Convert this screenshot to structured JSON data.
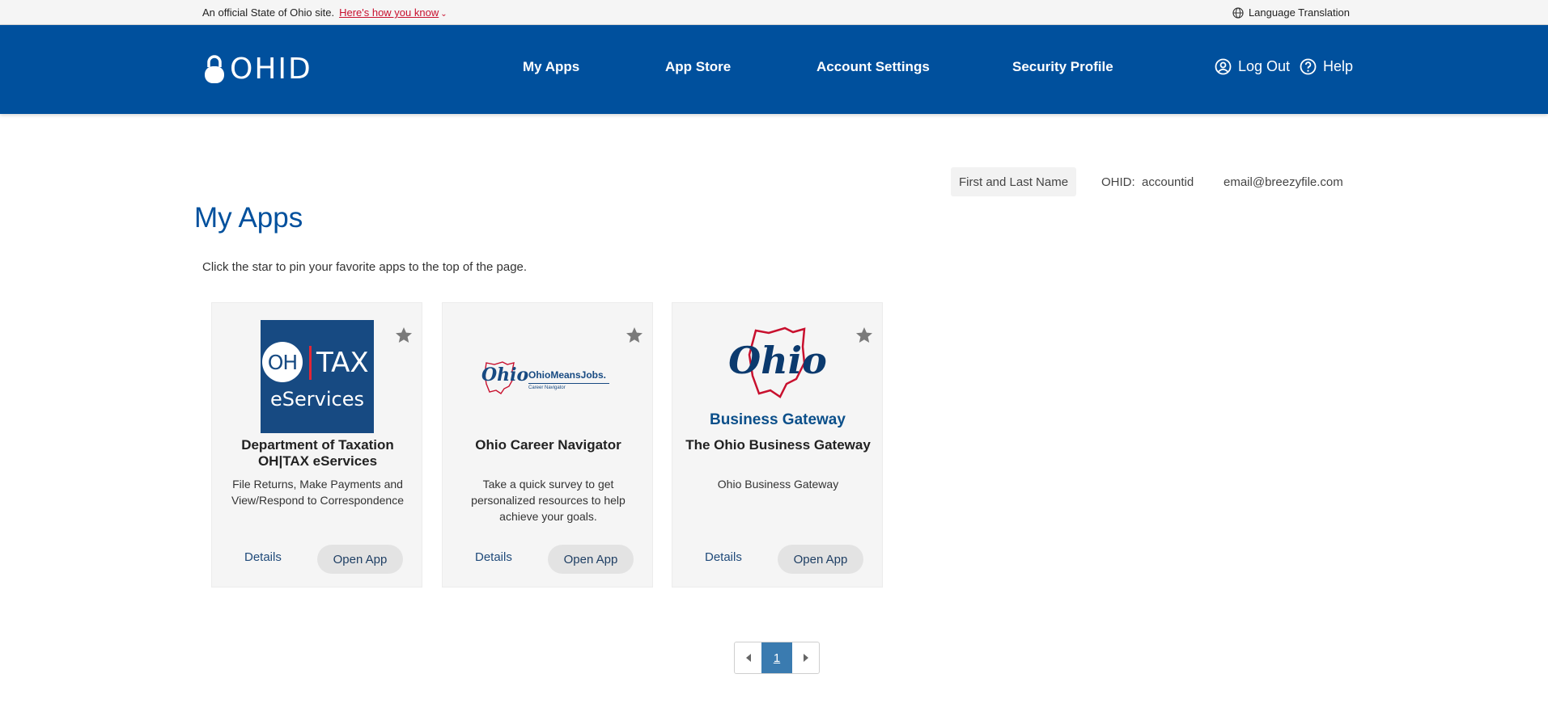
{
  "gov_banner": {
    "text": "An official State of Ohio site.",
    "link": "Here's how you know",
    "language": "Language Translation"
  },
  "header": {
    "logo": "OHID",
    "nav": [
      "My Apps",
      "App Store",
      "Account Settings",
      "Security Profile"
    ],
    "logout": "Log Out",
    "help": "Help"
  },
  "account": {
    "name": "First and Last Name",
    "ohid_label": "OHID:",
    "ohid_value": "accountid",
    "email": "email@breezyfile.com"
  },
  "page": {
    "title": "My Apps",
    "subtitle": "Click the star to pin your favorite apps to the top of the page."
  },
  "cards": [
    {
      "logo_line1_left": "OH",
      "logo_line1_right": "TAX",
      "logo_line2": "eServices",
      "title": "Department of Taxation OH|TAX eServices",
      "desc": "File Returns, Make Payments and View/Respond to Correspondence",
      "details": "Details",
      "open": "Open App"
    },
    {
      "logo_script": "Ohio",
      "logo_brand": "OhioMeansJobs.",
      "logo_tag": "Career Navigator",
      "title": "Ohio Career Navigator",
      "desc": "Take a quick survey to get personalized resources to help achieve your goals.",
      "details": "Details",
      "open": "Open App"
    },
    {
      "logo_script": "Ohio",
      "logo_caption": "Business Gateway",
      "title": "The Ohio Business Gateway",
      "desc": "Ohio Business Gateway",
      "details": "Details",
      "open": "Open App"
    }
  ],
  "pagination": {
    "current": "1"
  },
  "colors": {
    "header_blue": "#00509d",
    "gov_red": "#c8102e",
    "pager_blue": "#3a7bb0"
  }
}
